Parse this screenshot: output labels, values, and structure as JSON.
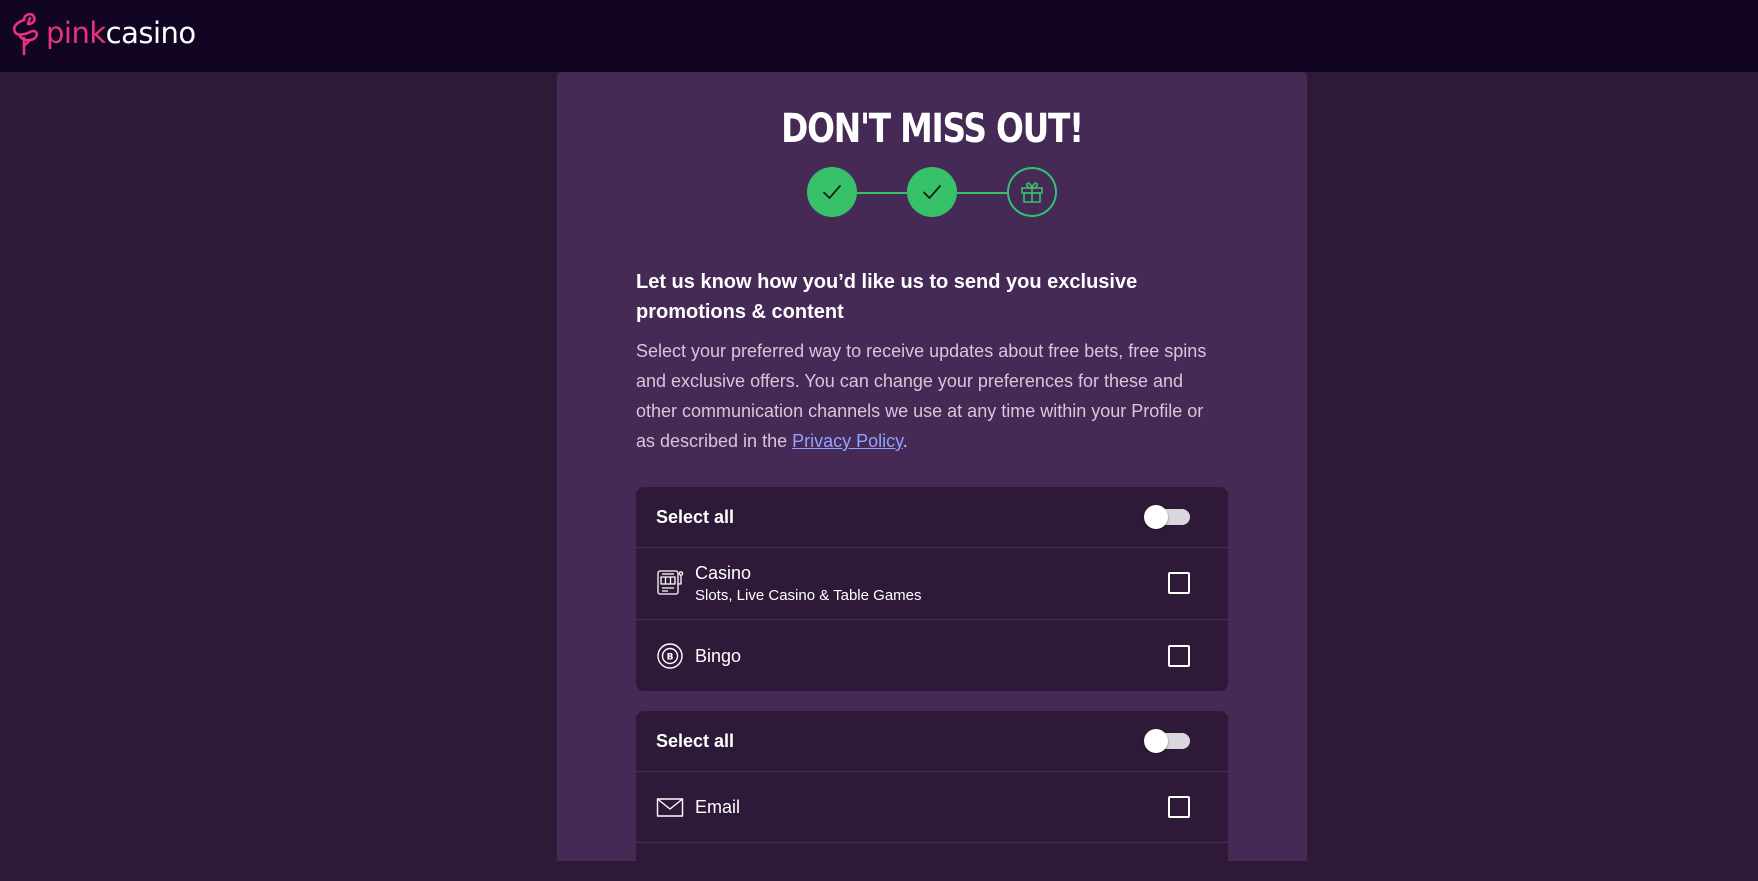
{
  "header": {
    "logo_part1": "pink",
    "logo_part2": "casino",
    "brand_color": "#e8337a",
    "background": "#120524"
  },
  "modal": {
    "title": "DON'T MISS OUT!",
    "stepper": {
      "steps": [
        {
          "state": "complete",
          "icon": "check-icon"
        },
        {
          "state": "complete",
          "icon": "check-icon"
        },
        {
          "state": "current",
          "icon": "gift-icon"
        }
      ],
      "accent_color": "#37c26a"
    },
    "heading": "Let us know how you’d like us to send you exclusive promotions & content",
    "description_before_link": "Select your preferred way to receive updates about free bets, free spins and exclusive offers. You can change your preferences for these and other communication channels we use at any time within your Profile or as described in the ",
    "privacy_link": "Privacy Policy",
    "description_after_link": ".",
    "products_group": {
      "select_all_label": "Select all",
      "select_all_on": false,
      "items": [
        {
          "icon": "slot-machine-icon",
          "title": "Casino",
          "subtitle": "Slots, Live Casino & Table Games",
          "checked": false
        },
        {
          "icon": "bingo-ball-icon",
          "title": "Bingo",
          "checked": false
        }
      ]
    },
    "channels_group": {
      "select_all_label": "Select all",
      "select_all_on": false,
      "items": [
        {
          "icon": "envelope-icon",
          "title": "Email",
          "checked": false
        }
      ]
    }
  }
}
